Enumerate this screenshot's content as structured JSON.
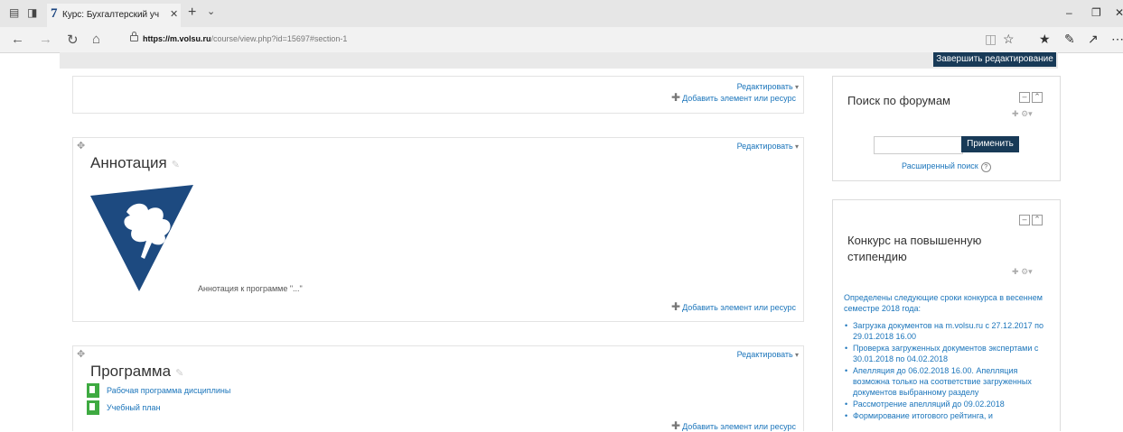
{
  "browser": {
    "tab_title": "Курс: Бухгалтерский уч",
    "tab_logo": "7",
    "url_host": "https://m.volsu.ru",
    "url_path": "/course/view.php?id=15697#section-1",
    "icons": [
      "tab-preview-icon",
      "tab-set-aside-icon",
      "close-icon",
      "new-tab-icon",
      "tab-dropdown-icon",
      "back-icon",
      "forward-icon",
      "refresh-icon",
      "home-icon",
      "lock-icon",
      "reading-view-icon",
      "favorite-star-icon",
      "favorites-icon",
      "notes-icon",
      "share-icon",
      "more-icon",
      "minimize-icon",
      "restore-icon",
      "window-close-icon"
    ]
  },
  "header": {
    "finish_editing": "Завершить редактирование"
  },
  "sections": {
    "general": {
      "edit": "Редактировать",
      "add": "Добавить элемент или ресурс"
    },
    "annotation": {
      "title": "Аннотация",
      "edit": "Редактировать",
      "label_text": "Аннотация к программе \"...\"",
      "add": "Добавить элемент или ресурс"
    },
    "program": {
      "title": "Программа",
      "edit": "Редактировать",
      "resources": [
        "Рабочая программа дисциплины",
        "Учебный план"
      ],
      "add": "Добавить элемент или ресурс"
    }
  },
  "blocks": {
    "forum_search": {
      "title": "Поиск по форумам",
      "apply": "Применить",
      "advanced": "Расширенный поиск",
      "search_value": ""
    },
    "contest": {
      "title_line1": "Конкурс на повышенную",
      "title_line2": "стипендию",
      "intro": "Определены следующие сроки конкурса в весеннем семестре 2018 года:",
      "items": [
        "Загрузка документов на m.volsu.ru с 27.12.2017 по 29.01.2018 16.00",
        "Проверка загруженных документов экспертами с 30.01.2018 по 04.02.2018",
        "Апелляция до 06.02.2018 16.00. Апелляция возможна только на соответствие загруженных документов выбранному разделу",
        "Рассмотрение апелляций до 09.02.2018",
        "Формирование итогового рейтинга, и"
      ]
    }
  },
  "colors": {
    "accent": "#183a57",
    "link": "#1b75bb",
    "logo": "#1d4a80",
    "file_icon": "#3eaa41"
  }
}
